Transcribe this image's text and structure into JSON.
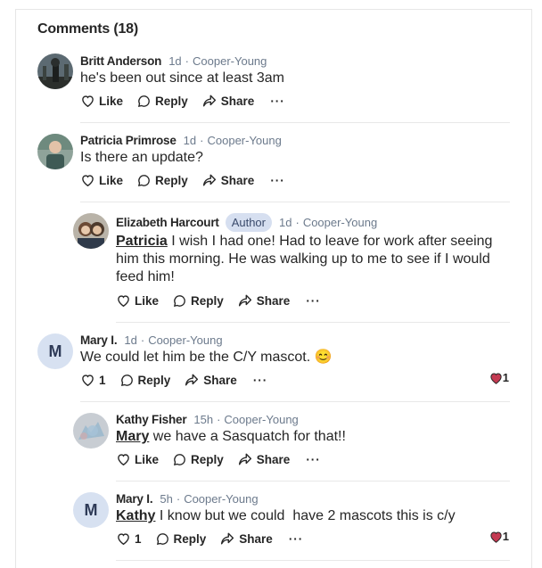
{
  "header": {
    "title": "Comments (18)"
  },
  "comments": [
    {
      "name": "Britt Anderson",
      "time": "1d",
      "neighborhood": "Cooper-Young",
      "text": "he's been out since at least 3am",
      "like": "Like",
      "reply": "Reply",
      "share": "Share",
      "more": "···"
    },
    {
      "name": "Patricia Primrose",
      "time": "1d",
      "neighborhood": "Cooper-Young",
      "text": "Is there an update?",
      "like": "Like",
      "reply": "Reply",
      "share": "Share",
      "more": "···"
    },
    {
      "name": "Elizabeth Harcourt",
      "badge": "Author",
      "time": "1d",
      "neighborhood": "Cooper-Young",
      "mention": "Patricia",
      "text": " I wish I had one! Had to leave for work after seeing him this morning. He was walking up to me to see if I would feed him!",
      "like": "Like",
      "reply": "Reply",
      "share": "Share",
      "more": "···"
    },
    {
      "name": "Mary I.",
      "initial": "M",
      "time": "1d",
      "neighborhood": "Cooper-Young",
      "text": "We could let him be the C/Y mascot. 😊",
      "like_count": "1",
      "reply": "Reply",
      "share": "Share",
      "more": "···",
      "reaction_count": "1"
    },
    {
      "name": "Kathy Fisher",
      "time": "15h",
      "neighborhood": "Cooper-Young",
      "mention": "Mary",
      "text": " we have a Sasquatch for that!!",
      "like": "Like",
      "reply": "Reply",
      "share": "Share",
      "more": "···"
    },
    {
      "name": "Mary I.",
      "initial": "M",
      "time": "5h",
      "neighborhood": "Cooper-Young",
      "mention": "Kathy",
      "text": " I know but we could  have 2 mascots this is c/y",
      "like_count": "1",
      "reply": "Reply",
      "share": "Share",
      "more": "···",
      "reaction_count": "1"
    }
  ],
  "meta_separator": "·",
  "colors": {
    "accent": "#d6dff0",
    "muted": "#6c7a8c",
    "heart": "#c43a52"
  },
  "icons": {
    "like": "heart-outline-icon",
    "reply": "speech-bubble-icon",
    "share": "share-arrow-icon",
    "reaction": "heart-reaction-icon"
  }
}
